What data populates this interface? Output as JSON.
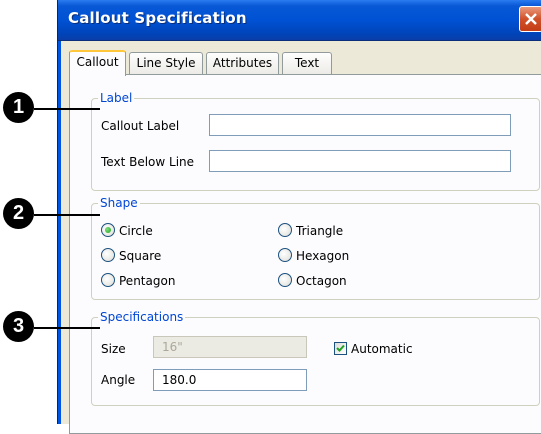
{
  "window": {
    "title": "Callout Specification"
  },
  "tabs": [
    {
      "label": "Callout",
      "active": true
    },
    {
      "label": "Line Style",
      "active": false
    },
    {
      "label": "Attributes",
      "active": false
    },
    {
      "label": "Text",
      "active": false
    }
  ],
  "label_group": {
    "legend": "Label",
    "callout_label": {
      "label": "Callout Label",
      "value": ""
    },
    "text_below_line": {
      "label": "Text Below Line",
      "value": ""
    }
  },
  "shape_group": {
    "legend": "Shape",
    "selected": "Circle",
    "options": [
      "Circle",
      "Square",
      "Pentagon",
      "Triangle",
      "Hexagon",
      "Octagon"
    ]
  },
  "spec_group": {
    "legend": "Specifications",
    "size": {
      "label": "Size",
      "value": "16\"",
      "disabled": true
    },
    "automatic": {
      "label": "Automatic",
      "checked": true
    },
    "angle": {
      "label": "Angle",
      "value": "180.0"
    }
  },
  "callouts": [
    "1",
    "2",
    "3"
  ],
  "colors": {
    "title_bar": "#0052d4",
    "group_legend": "#0046d5",
    "tab_highlight": "#ffc83c"
  }
}
